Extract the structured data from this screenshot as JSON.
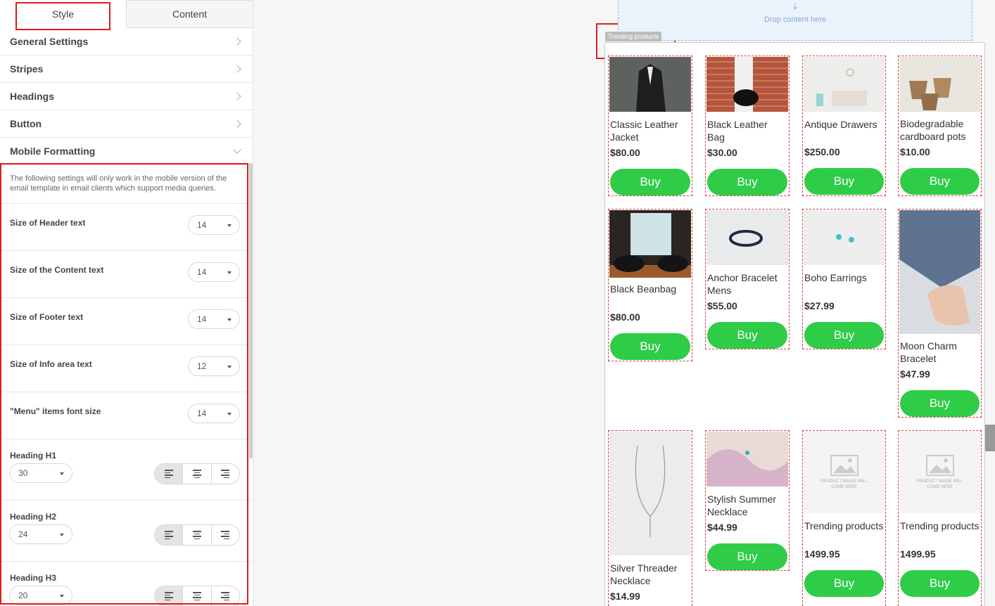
{
  "tabs": {
    "style": "Style",
    "content": "Content"
  },
  "sections": {
    "general": "General Settings",
    "stripes": "Stripes",
    "headings": "Headings",
    "button": "Button",
    "mobile": "Mobile Formatting"
  },
  "mobile": {
    "description": "The following settings will only work in the mobile version of the email template in email clients which support media queries.",
    "rows": [
      {
        "label": "Size of Header text",
        "value": "14"
      },
      {
        "label": "Size of the Content text",
        "value": "14"
      },
      {
        "label": "Size of Footer text",
        "value": "14"
      },
      {
        "label": "Size of Info area text",
        "value": "12"
      },
      {
        "label": "\"Menu\" items font size",
        "value": "14"
      }
    ],
    "headings": [
      {
        "label": "Heading H1",
        "value": "30"
      },
      {
        "label": "Heading H2",
        "value": "24"
      },
      {
        "label": "Heading H3",
        "value": "20"
      }
    ]
  },
  "preview": {
    "drop_label": "Drop content here",
    "block_tag": "Trending products",
    "buy_label": "Buy",
    "placeholder_text": "PRODUCT IMAGE WILL COME HERE",
    "products": [
      {
        "name": "Classic Leather Jacket",
        "price": "$80.00"
      },
      {
        "name": "Black Leather Bag",
        "price": "$30.00"
      },
      {
        "name": "Antique Drawers",
        "price": "$250.00"
      },
      {
        "name": "Biodegradable cardboard pots",
        "price": "$10.00"
      },
      {
        "name": "Black Beanbag",
        "price": "$80.00"
      },
      {
        "name": "Anchor Bracelet Mens",
        "price": "$55.00"
      },
      {
        "name": "Boho Earrings",
        "price": "$27.99"
      },
      {
        "name": "Moon Charm Bracelet",
        "price": "$47.99"
      },
      {
        "name": "Silver Threader Necklace",
        "price": "$14.99"
      },
      {
        "name": "Stylish Summer Necklace",
        "price": "$44.99"
      },
      {
        "name": "Trending products",
        "price": "1499.95"
      },
      {
        "name": "Trending products",
        "price": "1499.95"
      }
    ]
  }
}
